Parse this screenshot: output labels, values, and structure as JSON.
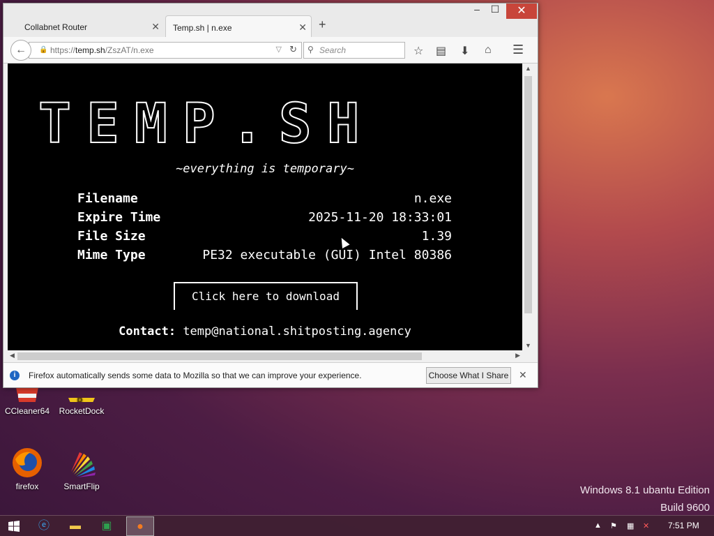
{
  "desktop": {
    "icons": [
      {
        "label": "CCleaner64",
        "icon": "ccleaner-icon"
      },
      {
        "label": "RocketDock",
        "icon": "rocketdock-icon"
      },
      {
        "label": "firefox",
        "icon": "firefox-icon"
      },
      {
        "label": "SmartFlip",
        "icon": "smartflip-icon"
      }
    ],
    "watermark_line1": "Windows 8.1 ubantu Edition",
    "watermark_line2": "Build 9600"
  },
  "browser": {
    "tabs": [
      {
        "label": "Collabnet Router",
        "active": false
      },
      {
        "label": "Temp.sh | n.exe",
        "active": true
      }
    ],
    "new_tab_icon": "+",
    "window_buttons": {
      "minimize": "–",
      "maximize": "☐",
      "close": "✕"
    },
    "url": {
      "scheme": "https://",
      "host": "temp.sh",
      "path": "/ZszAT/n.exe"
    },
    "search_placeholder": "Search"
  },
  "page": {
    "logo": "TEMP.SH",
    "tagline": "~everything is temporary~",
    "info": [
      {
        "label": "Filename",
        "value": "n.exe"
      },
      {
        "label": "Expire Time",
        "value": "2025-11-20 18:33:01"
      },
      {
        "label": "File Size",
        "value": "1.39"
      },
      {
        "label": "Mime Type",
        "value": "PE32 executable (GUI) Intel 80386"
      }
    ],
    "download_label": "Click here to download n.exe",
    "contact_label": "Contact:",
    "contact_email": "temp@national.shitposting.agency"
  },
  "notification": {
    "text": "Firefox automatically sends some data to Mozilla so that we can improve your experience.",
    "button": "Choose What I Share"
  },
  "taskbar": {
    "clock": "7:51 PM",
    "items": [
      "start-icon",
      "internet-explorer-icon",
      "file-explorer-icon",
      "excel-icon",
      "firefox-icon"
    ]
  },
  "colors": {
    "page_background": "#000000",
    "page_text": "#ffffff",
    "close_button": "#c8453a",
    "info_icon": "#1f66c3"
  }
}
